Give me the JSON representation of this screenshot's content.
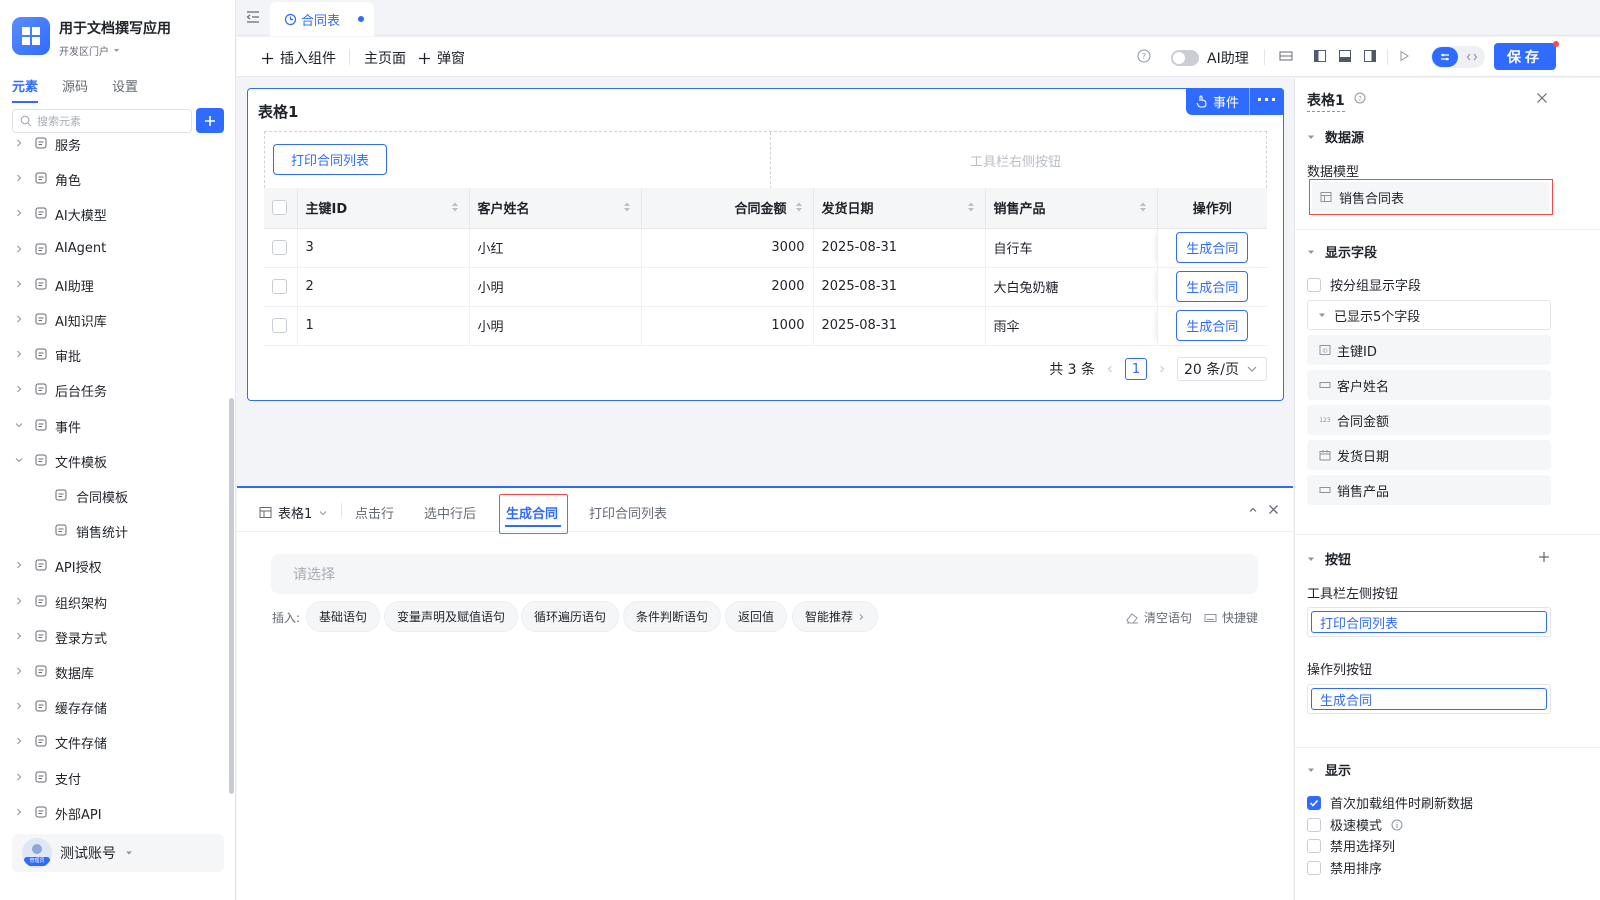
{
  "app": {
    "title": "用于文档撰写应用",
    "portal": "开发区门户"
  },
  "sidebar": {
    "tabs": [
      {
        "label": "元素",
        "active": true
      },
      {
        "label": "源码"
      },
      {
        "label": "设置"
      }
    ],
    "search_placeholder": "搜索元素",
    "items": [
      {
        "label": "服务",
        "icon": "server-icon"
      },
      {
        "label": "角色",
        "icon": "user-role-icon"
      },
      {
        "label": "AI大模型",
        "icon": "cube-icon"
      },
      {
        "label": "AIAgent",
        "icon": "robot-icon"
      },
      {
        "label": "AI助理",
        "icon": "ai-assistant-icon"
      },
      {
        "label": "AI知识库",
        "icon": "book-icon"
      },
      {
        "label": "审批",
        "icon": "stamp-icon"
      },
      {
        "label": "后台任务",
        "icon": "clipboard-icon"
      },
      {
        "label": "事件",
        "icon": "event-icon",
        "expanded": true
      },
      {
        "label": "文件模板",
        "icon": "file-template-icon",
        "expanded": true
      },
      {
        "label": "合同模板",
        "icon": "word-file-icon",
        "child": true
      },
      {
        "label": "销售统计",
        "icon": "excel-file-icon",
        "child": true
      },
      {
        "label": "API授权",
        "icon": "key-icon"
      },
      {
        "label": "组织架构",
        "icon": "org-chart-icon"
      },
      {
        "label": "登录方式",
        "icon": "building-icon"
      },
      {
        "label": "数据库",
        "icon": "database-icon"
      },
      {
        "label": "缓存存储",
        "icon": "cache-icon"
      },
      {
        "label": "文件存储",
        "icon": "folder-icon"
      },
      {
        "label": "支付",
        "icon": "payment-icon"
      },
      {
        "label": "外部API",
        "icon": "api-icon"
      }
    ],
    "user": {
      "name": "测试账号",
      "badge": "管理员"
    }
  },
  "tabs": {
    "doc_tab": "合同表"
  },
  "toolbar": {
    "insert_component": "插入组件",
    "home_page": "主页面",
    "popup": "弹窗",
    "ai_assistant": "AI助理",
    "save": "保存"
  },
  "table_card": {
    "title": "表格1",
    "event_btn": "事件",
    "more_btn": "···",
    "print_btn": "打印合同列表",
    "right_toolbar_hint": "工具栏右侧按钮",
    "columns": [
      "主键ID",
      "客户姓名",
      "合同金额",
      "发货日期",
      "销售产品",
      "操作列"
    ],
    "rows": [
      [
        "3",
        "小红",
        "3000",
        "2025-08-31",
        "自行车"
      ],
      [
        "2",
        "小明",
        "2000",
        "2025-08-31",
        "大白兔奶糖"
      ],
      [
        "1",
        "小明",
        "1000",
        "2025-08-31",
        "雨伞"
      ]
    ],
    "row_action": "生成合同",
    "pager": {
      "total": "共 3 条",
      "page": "1",
      "size": "20 条/页"
    }
  },
  "event_panel": {
    "component": "表格1",
    "tabs": [
      "点击行",
      "选中行后",
      "生成合同",
      "打印合同列表"
    ],
    "active_tab": "生成合同",
    "select_placeholder": "请选择",
    "insert_label": "插入:",
    "chips": [
      "基础语句",
      "变量声明及赋值语句",
      "循环遍历语句",
      "条件判断语句",
      "返回值",
      "智能推荐"
    ],
    "clear": "清空语句",
    "shortcuts": "快捷键"
  },
  "props": {
    "title": "表格1",
    "datasource": {
      "section": "数据源",
      "model_label": "数据模型",
      "model": "销售合同表"
    },
    "fields": {
      "section": "显示字段",
      "group_toggle": "按分组显示字段",
      "shown": "已显示5个字段",
      "list": [
        {
          "label": "主键ID",
          "icon": "id-icon"
        },
        {
          "label": "客户姓名",
          "icon": "text-field-icon"
        },
        {
          "label": "合同金额",
          "icon": "number-icon"
        },
        {
          "label": "发货日期",
          "icon": "calendar-icon"
        },
        {
          "label": "销售产品",
          "icon": "text-field-icon"
        }
      ]
    },
    "buttons": {
      "section": "按钮",
      "left_label": "工具栏左侧按钮",
      "left_value": "打印合同列表",
      "op_label": "操作列按钮",
      "op_value": "生成合同"
    },
    "display": {
      "section": "显示",
      "options": [
        {
          "label": "首次加载组件时刷新数据",
          "checked": true
        },
        {
          "label": "极速模式",
          "checked": false
        },
        {
          "label": "禁用选择列",
          "checked": false
        },
        {
          "label": "禁用排序",
          "checked": false
        }
      ]
    }
  },
  "colors": {
    "accent": "#2f6bff",
    "highlight": "#f54a45"
  }
}
